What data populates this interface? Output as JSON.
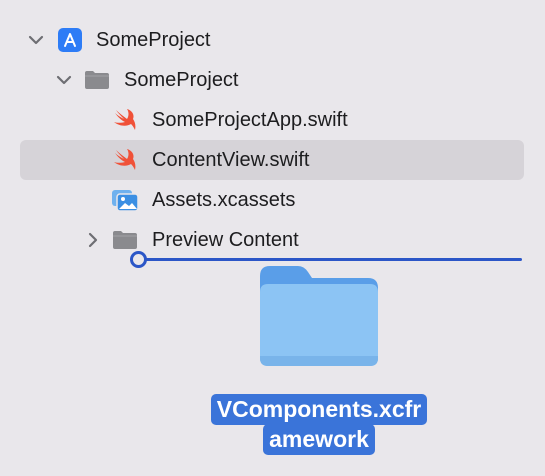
{
  "navigator": {
    "items": [
      {
        "label": "SomeProject",
        "type": "project",
        "expanded": true
      },
      {
        "label": "SomeProject",
        "type": "group",
        "expanded": true
      },
      {
        "label": "SomeProjectApp.swift",
        "type": "swift-file"
      },
      {
        "label": "ContentView.swift",
        "type": "swift-file",
        "selected": true
      },
      {
        "label": "Assets.xcassets",
        "type": "asset-catalog"
      },
      {
        "label": "Preview Content",
        "type": "group",
        "expanded": false
      }
    ]
  },
  "drag": {
    "name_line1": "VComponents.xcfr",
    "name_line2": "amework",
    "icon": "folder-icon"
  },
  "colors": {
    "background": "#e9e7eb",
    "selection": "#d6d3d8",
    "drop_indicator": "#2b56c7",
    "swift_orange": "#f05138",
    "project_blue": "#2d7cf6",
    "drag_label_bg": "#3a74d9"
  }
}
